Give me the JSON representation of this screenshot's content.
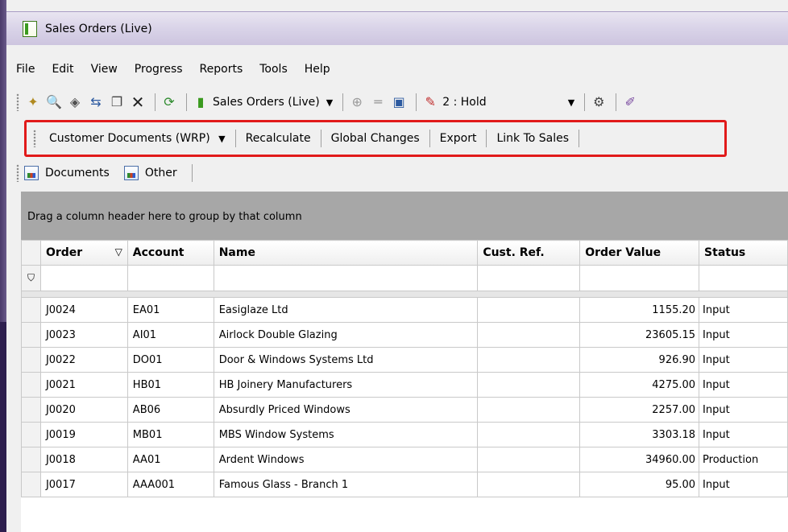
{
  "window": {
    "title": "Sales Orders (Live)"
  },
  "menu": [
    "File",
    "Edit",
    "View",
    "Progress",
    "Reports",
    "Tools",
    "Help"
  ],
  "toolbar": {
    "dataset_combo": "Sales Orders (Live)",
    "hold_combo": "2 : Hold",
    "icons": [
      "new-icon",
      "preview-icon",
      "package-icon",
      "transfer-icon",
      "copy-icon",
      "delete-icon",
      "refresh-icon",
      "document-icon",
      "add-row-icon",
      "remove-row-icon",
      "view-icon",
      "hold-icon",
      "properties-icon",
      "pencil-icon"
    ]
  },
  "actions": {
    "customer_documents": "Customer Documents (WRP)",
    "recalculate": "Recalculate",
    "global_changes": "Global Changes",
    "export": "Export",
    "link_to_sales": "Link To Sales"
  },
  "docs_bar": {
    "documents": "Documents",
    "other": "Other"
  },
  "grid": {
    "group_hint": "Drag a column header here to group by that column",
    "columns": [
      "Order",
      "Account",
      "Name",
      "Cust. Ref.",
      "Order Value",
      "Status"
    ],
    "sort_indicator": "▽",
    "filter_icon": "filter-icon",
    "rows": [
      {
        "order": "J0024",
        "account": "EA01",
        "name": "Easiglaze Ltd",
        "cust_ref": "",
        "value": "1155.20",
        "status": "Input"
      },
      {
        "order": "J0023",
        "account": "AI01",
        "name": "Airlock Double Glazing",
        "cust_ref": "",
        "value": "23605.15",
        "status": "Input"
      },
      {
        "order": "J0022",
        "account": "DO01",
        "name": "Door & Windows Systems Ltd",
        "cust_ref": "",
        "value": "926.90",
        "status": "Input"
      },
      {
        "order": "J0021",
        "account": "HB01",
        "name": "HB Joinery Manufacturers",
        "cust_ref": "",
        "value": "4275.00",
        "status": "Input"
      },
      {
        "order": "J0020",
        "account": "AB06",
        "name": "Absurdly Priced Windows",
        "cust_ref": "",
        "value": "2257.00",
        "status": "Input"
      },
      {
        "order": "J0019",
        "account": "MB01",
        "name": "MBS Window Systems",
        "cust_ref": "",
        "value": "3303.18",
        "status": "Input"
      },
      {
        "order": "J0018",
        "account": "AA01",
        "name": "Ardent Windows",
        "cust_ref": "",
        "value": "34960.00",
        "status": "Production"
      },
      {
        "order": "J0017",
        "account": "AAA001",
        "name": "Famous Glass - Branch 1",
        "cust_ref": "",
        "value": "95.00",
        "status": "Input"
      }
    ]
  },
  "colors": {
    "highlight": "#e11a1a",
    "title_bar": "#d9d3e8",
    "group_panel": "#a7a7a7"
  }
}
